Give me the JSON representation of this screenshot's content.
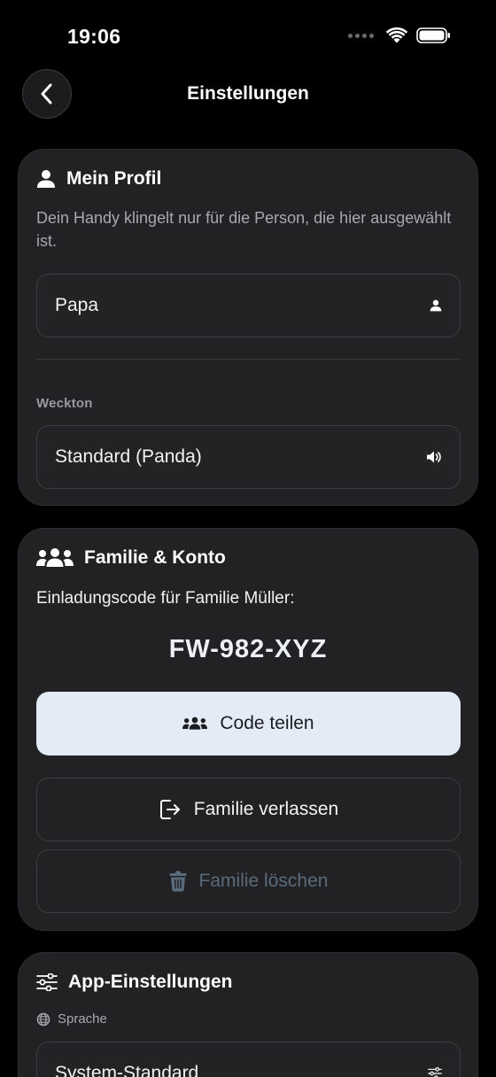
{
  "status_bar": {
    "time": "19:06"
  },
  "nav": {
    "title": "Einstellungen"
  },
  "profile": {
    "title": "Mein Profil",
    "hint": "Dein Handy klingelt nur für die Person, die hier ausgewählt ist.",
    "person_value": "Papa",
    "ringtone_label": "Weckton",
    "ringtone_value": "Standard (Panda)"
  },
  "family": {
    "title": "Familie & Konto",
    "invite_label": "Einladungscode für Familie Müller:",
    "invite_code": "FW-982-XYZ",
    "share_label": "Code teilen",
    "leave_label": "Familie verlassen",
    "delete_label": "Familie löschen"
  },
  "app_settings": {
    "title": "App-Einstellungen",
    "language_label": "Sprache",
    "language_value": "System-Standard"
  },
  "colors": {
    "background": "#000000",
    "card": "#222224",
    "primary_button": "#e3ecf6",
    "disabled_text": "#5a6b7c"
  }
}
